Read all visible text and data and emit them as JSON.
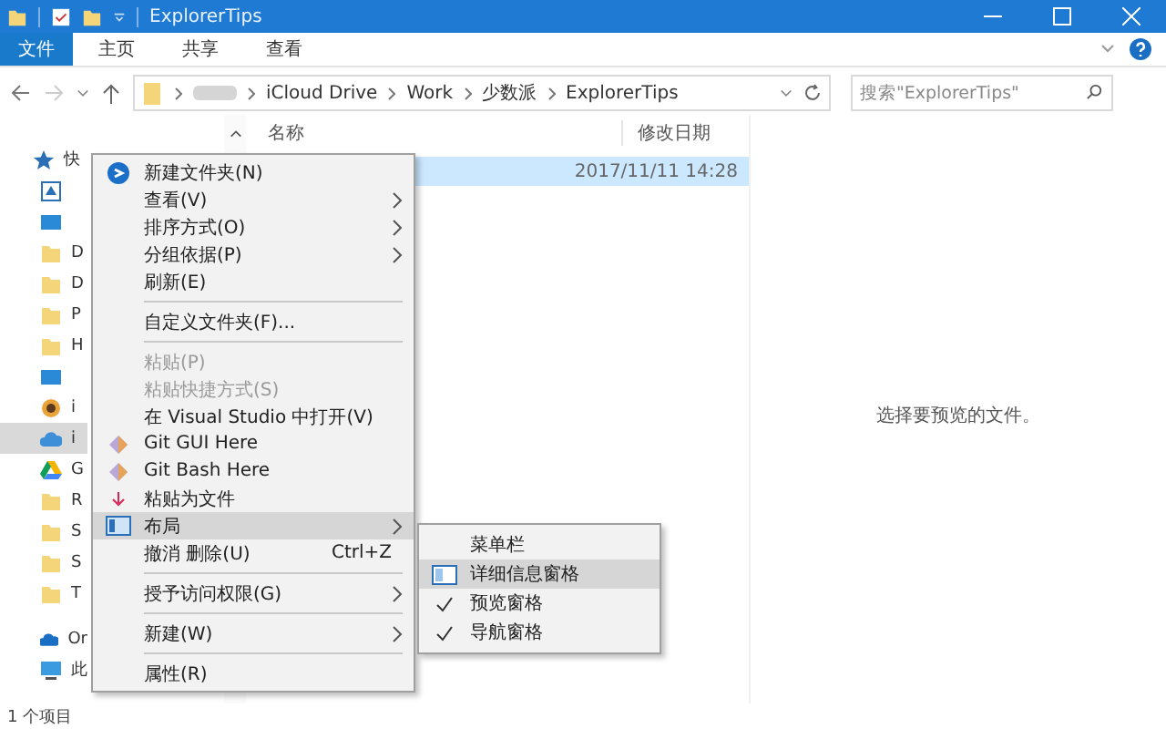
{
  "window": {
    "title": "ExplorerTips"
  },
  "ribbon_tabs": [
    {
      "label": "文件",
      "selected": true
    },
    {
      "label": "主页",
      "selected": false
    },
    {
      "label": "共享",
      "selected": false
    },
    {
      "label": "查看",
      "selected": false
    }
  ],
  "address_bar": {
    "path": [
      "iCloud Drive",
      "Work",
      "少数派",
      "ExplorerTips"
    ]
  },
  "search": {
    "placeholder": "搜索\"ExplorerTips\""
  },
  "nav_pane": {
    "items": [
      {
        "kind": "star",
        "label": "快",
        "selected": false
      },
      {
        "kind": "doc",
        "selected": false
      },
      {
        "kind": "monitor",
        "selected": false
      },
      {
        "kind": "folder",
        "label": "D",
        "selected": false
      },
      {
        "kind": "folder",
        "label": "D",
        "selected": false
      },
      {
        "kind": "folder",
        "label": "P",
        "selected": false
      },
      {
        "kind": "folder",
        "label": "H",
        "selected": false
      },
      {
        "kind": "monitor",
        "selected": false
      },
      {
        "kind": "app",
        "label": "i",
        "selected": false
      },
      {
        "kind": "cloud",
        "label": "i",
        "selected": true
      },
      {
        "kind": "drive",
        "label": "G",
        "selected": false
      },
      {
        "kind": "folder",
        "label": "R",
        "selected": false
      },
      {
        "kind": "folder",
        "label": "S",
        "selected": false
      },
      {
        "kind": "folder",
        "label": "S",
        "selected": false
      },
      {
        "kind": "folder",
        "label": "T",
        "selected": false
      },
      {
        "kind": "onedrive",
        "label": "Or",
        "selected": false
      },
      {
        "kind": "pc",
        "label": "此",
        "selected": false
      }
    ]
  },
  "file_list": {
    "columns": [
      "名称",
      "修改日期"
    ],
    "rows": [
      {
        "modified": "2017/11/11 14:28",
        "selected": true
      }
    ]
  },
  "preview_pane": {
    "message": "选择要预览的文件。"
  },
  "status_bar": {
    "item_count": "1 个项目"
  },
  "context_menu": {
    "items": [
      {
        "kind": "new-folder",
        "label": "新建文件夹(N)",
        "disabled": false,
        "submenu": false,
        "selected": false
      },
      {
        "kind": "item",
        "label": "查看(V)",
        "disabled": false,
        "submenu": true,
        "selected": false
      },
      {
        "kind": "item",
        "label": "排序方式(O)",
        "disabled": false,
        "submenu": true,
        "selected": false
      },
      {
        "kind": "item",
        "label": "分组依据(P)",
        "disabled": false,
        "submenu": true,
        "selected": false
      },
      {
        "kind": "item",
        "label": "刷新(E)",
        "disabled": false,
        "submenu": false,
        "selected": false
      },
      {
        "kind": "separator"
      },
      {
        "kind": "item",
        "label": "自定义文件夹(F)...",
        "disabled": false,
        "submenu": false,
        "selected": false
      },
      {
        "kind": "separator"
      },
      {
        "kind": "item",
        "label": "粘贴(P)",
        "disabled": true,
        "submenu": false,
        "selected": false
      },
      {
        "kind": "item",
        "label": "粘贴快捷方式(S)",
        "disabled": true,
        "submenu": false,
        "selected": false
      },
      {
        "kind": "item",
        "label": "在 Visual Studio 中打开(V)",
        "disabled": false,
        "submenu": false,
        "selected": false
      },
      {
        "kind": "git",
        "label": "Git GUI Here",
        "disabled": false,
        "submenu": false,
        "selected": false
      },
      {
        "kind": "git",
        "label": "Git Bash Here",
        "disabled": false,
        "submenu": false,
        "selected": false
      },
      {
        "kind": "paste",
        "label": "粘贴为文件",
        "disabled": false,
        "submenu": false,
        "selected": false
      },
      {
        "kind": "layout",
        "label": "布局",
        "disabled": false,
        "submenu": true,
        "selected": true
      },
      {
        "kind": "item",
        "label": "撤消 删除(U)",
        "shortcut": "Ctrl+Z",
        "disabled": false,
        "submenu": false,
        "selected": false
      },
      {
        "kind": "separator"
      },
      {
        "kind": "item",
        "label": "授予访问权限(G)",
        "disabled": false,
        "submenu": true,
        "selected": false
      },
      {
        "kind": "separator"
      },
      {
        "kind": "item",
        "label": "新建(W)",
        "disabled": false,
        "submenu": true,
        "selected": false
      },
      {
        "kind": "separator"
      },
      {
        "kind": "item",
        "label": "属性(R)",
        "disabled": false,
        "submenu": false,
        "selected": false
      }
    ]
  },
  "layout_submenu": {
    "items": [
      {
        "kind": "check",
        "label": "菜单栏",
        "checked": false,
        "selected": false
      },
      {
        "kind": "pane-icon",
        "label": "详细信息窗格",
        "selected": true
      },
      {
        "kind": "check",
        "label": "预览窗格",
        "checked": true,
        "selected": false
      },
      {
        "kind": "check",
        "label": "导航窗格",
        "checked": true,
        "selected": false
      }
    ]
  }
}
